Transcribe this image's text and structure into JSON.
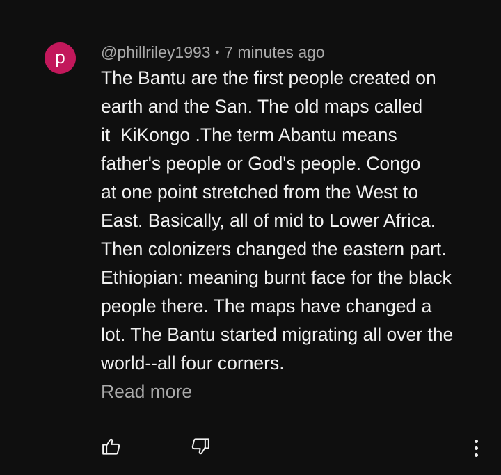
{
  "comment": {
    "avatar_letter": "p",
    "avatar_color": "#c2185b",
    "author": "@phillriley1993",
    "separator": "•",
    "timestamp": "7 minutes ago",
    "lines": [
      "The Bantu are the first people created on",
      "earth and the San. The old maps called",
      "it  KiKongo .The term Abantu means",
      "father's people or God's people. Congo",
      "at one point stretched from the West to",
      "East. Basically, all of mid to Lower Africa.",
      "Then colonizers changed the eastern part.",
      "Ethiopian: meaning burnt face for the black",
      "people there. The maps have changed a",
      "lot. The Bantu started migrating all over the",
      "world--all four corners."
    ],
    "read_more_label": "Read more"
  },
  "actions": {
    "like_icon": "thumbs-up-icon",
    "dislike_icon": "thumbs-down-icon",
    "more_icon": "more-vert-icon"
  },
  "colors": {
    "background": "#0f0f0f",
    "text": "#f1f1f1",
    "secondary_text": "#aaaaaa"
  }
}
